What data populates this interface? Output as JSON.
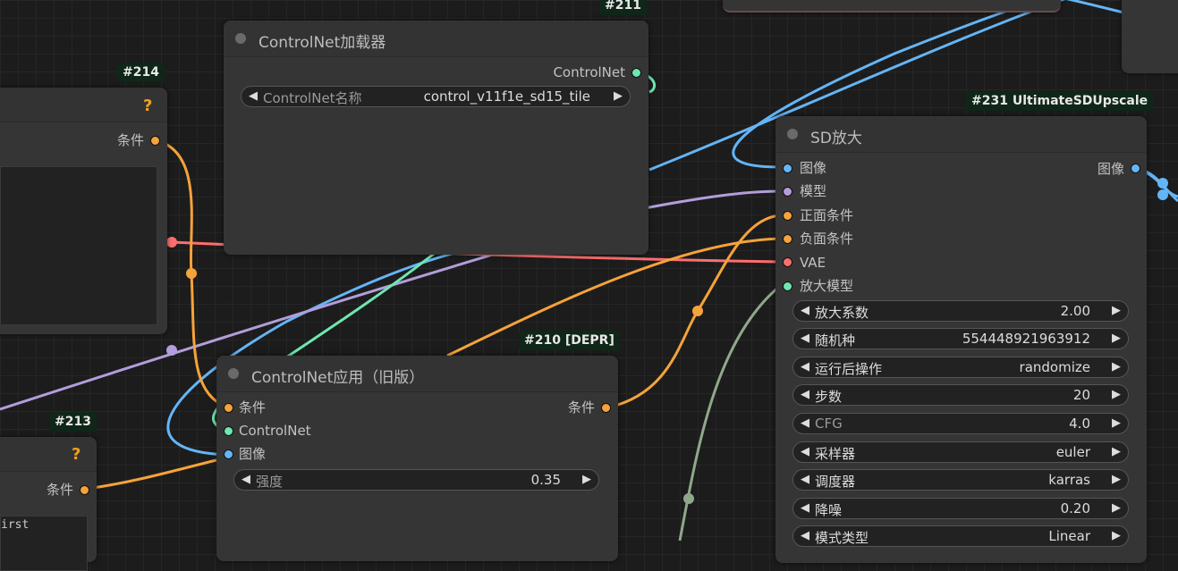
{
  "colors": {
    "conditioning": "#f5a33a",
    "image": "#64b5f6",
    "model": "#b39ddb",
    "vae": "#ff6e6e",
    "controlnet": "#6ee7b0",
    "upscale_model": "#8fa88a"
  },
  "nodes": {
    "n214": {
      "badge": "#214",
      "help": "?",
      "outputs": [
        "条件"
      ]
    },
    "n213": {
      "badge": "#213",
      "help": "?",
      "outputs": [
        "条件"
      ],
      "preview_text": "irst"
    },
    "n211": {
      "badge": "#211",
      "title": "ControlNet加载器",
      "outputs": [
        "ControlNet"
      ],
      "widgets": [
        {
          "label": "ControlNet名称",
          "value": "control_v11f1e_sd15_tile"
        }
      ]
    },
    "n210": {
      "badge": "#210 [DEPR]",
      "title": "ControlNet应用（旧版）",
      "inputs": [
        "条件",
        "ControlNet",
        "图像"
      ],
      "outputs": [
        "条件"
      ],
      "widgets": [
        {
          "label": "强度",
          "value": "0.35"
        }
      ]
    },
    "n231": {
      "badge": "#231 UltimateSDUpscale",
      "title": "SD放大",
      "inputs": [
        "图像",
        "模型",
        "正面条件",
        "负面条件",
        "VAE",
        "放大模型"
      ],
      "outputs": [
        "图像"
      ],
      "widgets": [
        {
          "label": "放大系数",
          "value": "2.00"
        },
        {
          "label": "随机种",
          "value": "554448921963912"
        },
        {
          "label": "运行后操作",
          "value": "randomize"
        },
        {
          "label": "步数",
          "value": "20"
        },
        {
          "label": "CFG",
          "value": "4.0"
        },
        {
          "label": "采样器",
          "value": "euler"
        },
        {
          "label": "调度器",
          "value": "karras"
        },
        {
          "label": "降噪",
          "value": "0.20"
        },
        {
          "label": "模式类型",
          "value": "Linear"
        }
      ]
    }
  }
}
